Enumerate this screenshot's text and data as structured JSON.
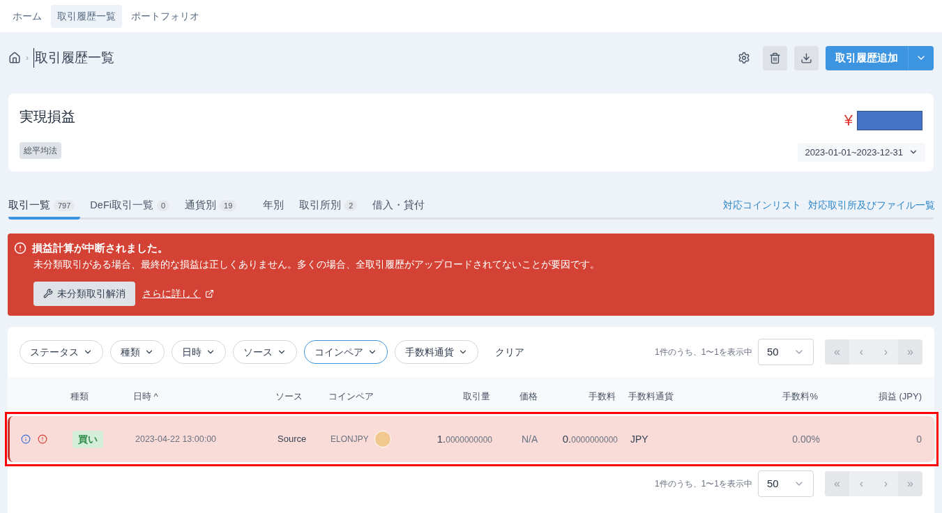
{
  "nav": [
    {
      "label": "ホーム",
      "selected": false
    },
    {
      "label": "取引履歴一覧",
      "selected": true
    },
    {
      "label": "ポートフォリオ",
      "selected": false
    }
  ],
  "breadcrumb": {
    "separator": "›",
    "title": "取引履歴一覧"
  },
  "actions": {
    "primary": "取引履歴追加"
  },
  "summary": {
    "title": "実現損益",
    "method": "総平均法",
    "currency": "¥",
    "period": "2023-01-01~2023-12-31"
  },
  "tabs": [
    {
      "label": "取引一覧",
      "count": "797",
      "selected": true
    },
    {
      "label": "DeFi取引一覧",
      "count": "0",
      "selected": false
    },
    {
      "label": "通貨別",
      "count": "19",
      "selected": false
    },
    {
      "label": "年別",
      "selected": false
    },
    {
      "label": "取引所別",
      "count": "2",
      "selected": false
    },
    {
      "label": "借入・貸付",
      "selected": false
    }
  ],
  "links": [
    "対応コインリスト",
    "対応取引所及びファイル一覧"
  ],
  "alert": {
    "title": "損益計算が中断されました。",
    "message": "未分類取引がある場合、最終的な損益は正しくありません。多くの場合、全取引履歴がアップロードされてないことが要因です。",
    "button": "未分類取引解消",
    "link": "さらに詳しく"
  },
  "filters": [
    {
      "label": "ステータス",
      "selected": false
    },
    {
      "label": "種類",
      "selected": false
    },
    {
      "label": "日時",
      "selected": false
    },
    {
      "label": "ソース",
      "selected": false
    },
    {
      "label": "コインペア",
      "selected": true
    },
    {
      "label": "手数料通貨",
      "selected": false
    }
  ],
  "clear": "クリア",
  "pagination_top": {
    "info": "1件のうち、1〜1を表示中",
    "page_size": "50",
    "buttons": [
      "«",
      "‹",
      "›",
      "»"
    ]
  },
  "table": {
    "columns": [
      "種類",
      "日時 ^",
      "ソース",
      "コインペア",
      "取引量",
      "価格",
      "手数料",
      "手数料通貨",
      "手数料%",
      "損益 (JPY)"
    ],
    "rows": [
      {
        "highlighted": true,
        "type": "買い",
        "datetime": "2023-04-22 13:00:00",
        "source": "Source",
        "pair": "ELONJPY",
        "amount": {
          "whole": "1.",
          "fraction": "0000000000"
        },
        "price": "N/A",
        "fee": {
          "whole": "0.",
          "fraction": "0000000000"
        },
        "fee_currency": "JPY",
        "fee_pct": "0.00%",
        "pnl": "0"
      }
    ]
  },
  "pagination_bottom": {
    "info": "1件のうち、1〜1を表示中",
    "page_size": "50",
    "buttons": [
      "«",
      "‹",
      "›",
      "»"
    ]
  }
}
